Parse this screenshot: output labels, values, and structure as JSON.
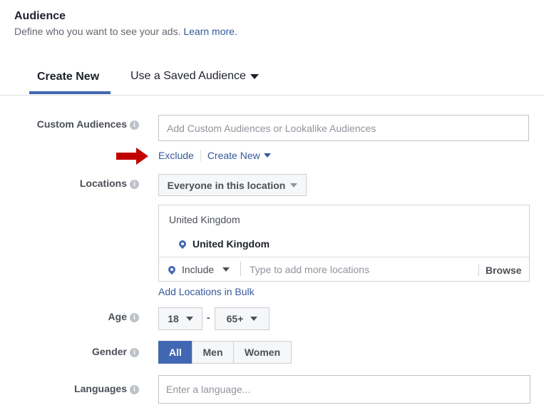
{
  "header": {
    "title": "Audience",
    "subtitle": "Define who you want to see your ads.",
    "learn_more": "Learn more."
  },
  "tabs": [
    {
      "label": "Create New",
      "active": true
    },
    {
      "label": "Use a Saved Audience",
      "active": false
    }
  ],
  "custom_audiences": {
    "label": "Custom Audiences",
    "placeholder": "Add Custom Audiences or Lookalike Audiences",
    "exclude": "Exclude",
    "create_new": "Create New"
  },
  "locations": {
    "label": "Locations",
    "dropdown": "Everyone in this location",
    "country_header": "United Kingdom",
    "selected": "United Kingdom",
    "include": "Include",
    "placeholder": "Type to add more locations",
    "browse": "Browse",
    "bulk": "Add Locations in Bulk"
  },
  "age": {
    "label": "Age",
    "min": "18",
    "separator": "-",
    "max": "65+"
  },
  "gender": {
    "label": "Gender",
    "options": [
      "All",
      "Men",
      "Women"
    ],
    "selected": "All"
  },
  "languages": {
    "label": "Languages",
    "placeholder": "Enter a language..."
  },
  "colors": {
    "accent": "#4267b2",
    "link": "#365899",
    "arrow": "#c20000"
  }
}
